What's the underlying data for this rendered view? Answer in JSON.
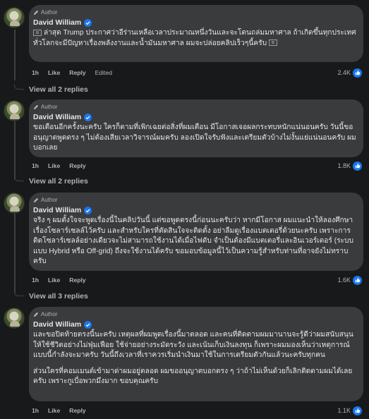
{
  "comments": [
    {
      "badge": "Author",
      "name": "David William",
      "paragraphs": [
        "ล่าสุด Trump ประกาศว่าอีร่านเหลือเวลาประมาณหนึ่งวันและจะโดนถล่มมหาศาล ถ้าเกิดขึ้นทุกประเทศทั่วโลกจะมีปัญหาเรื่องพลังงานและน้ำมันมหาศาล ผมจะปล่อยคลิปเร็วๆนี้ครับ"
      ],
      "time": "1h",
      "like": "Like",
      "reply": "Reply",
      "edited": "Edited",
      "reaction_count": "2.4K",
      "view_replies": "View all 2 replies"
    },
    {
      "badge": "Author",
      "name": "David William",
      "paragraphs": [
        "ขอเตือนอีกครั้งนะครับ ใครก็ตามที่เพิกเฉยต่อสิ่งที่ผมเตือน มีโอกาสเจอผลกระทบหนักแน่นอนครับ วันนี้ขออนุญาตพูดตรง ๆ ไม่ต้องเสียเวลาวิจารณ์ผมครับ ลองเปิดใจรับฟังและเตรียมตัวบ้างไม่งั้นแย่แน่นอนครับ ผมบอกเลย"
      ],
      "time": "1h",
      "like": "Like",
      "reply": "Reply",
      "reaction_count": "1.8K",
      "view_replies": "View all 2 replies"
    },
    {
      "badge": "Author",
      "name": "David William",
      "paragraphs": [
        "จริง ๆ ผมตั้งใจจะพูดเรื่องนี้ในคลิปวันนี้ แต่ขอพูดตรงนี้ก่อนนะครับว่า หากมีโอกาส ผมแนะนำให้ลองศึกษาเรื่องโซลาร์เซลล์ไว้ครับ และสำหรับใครที่ตัดสินใจจะติดตั้ง อย่าลืมดูเรื่องแบตเตอรี่ด้วยนะครับ เพราะการติดโซลาร์เซลล์อย่างเดียวจะไม่สามารถใช้งานได้เมื่อไฟดับ จำเป็นต้องมีแบตเตอรี่และอินเวอร์เตอร์ (ระบบแบบ Hybrid หรือ Off-grid) ถึงจะใช้งานได้ครับ ขอมอบข้อมูลนี้ไว้เป็นความรู้สำหรับท่านที่อาจยังไม่ทราบครับ"
      ],
      "time": "1h",
      "like": "Like",
      "reply": "Reply",
      "reaction_count": "1.6K",
      "view_replies": "View all 3 replies"
    },
    {
      "badge": "Author",
      "name": "David William",
      "paragraphs": [
        "และขอปิดท้ายตรงนี้นะครับ เหตุผลที่ผมพูดเรื่องนี้มาตลอด และคนที่ติดตามผมมานานจะรู้ดีว่าผมสนับสนุนให้ใช้ชีวิตอย่างไม่ฟุ่มเฟือย ใช้จ่ายอย่างระมัดระวัง และเน้นเก็บเงินลงทุน ก็เพราะผมมองเห็นว่าเหตุการณ์แบบนี้กำลังจะมาครับ วันนี้ถึงเวลาที่เราควรเริ่มนำเงินมาใช้ในการเตรียมตัวกันแล้วนะครับทุกคน",
        "ส่วนใครที่คอมเมนต์เข้ามาด่าผมอยู่ตลอด ผมขออนุญาตบอกตรง ๆ ว่าถ้าไม่เห็นด้วยก็เลิกติดตามผมได้เลยครับ เพราะกูเบื่อพวกมึงมาก ขอบคุณครับ"
      ],
      "time": "1h",
      "like": "Like",
      "reply": "Reply",
      "reaction_count": "1.1K"
    }
  ],
  "colors": {
    "background": "#18191a",
    "bubble": "#3a3b3c",
    "verified": "#1877f2",
    "muted_text": "#b0b3b8"
  }
}
